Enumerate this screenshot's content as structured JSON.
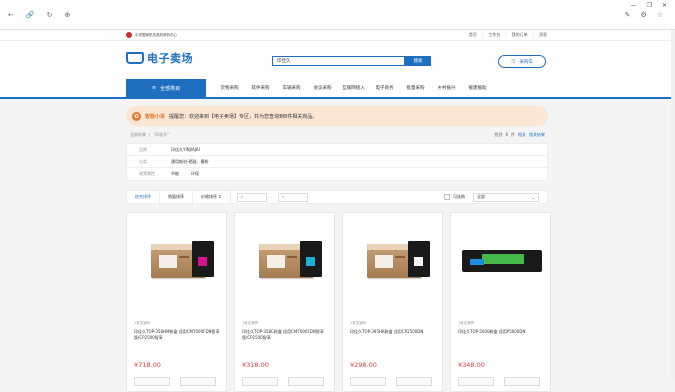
{
  "topbar": {
    "org": "中央国家机关政府采购中心",
    "links": [
      "首页",
      "工作台",
      "我的订单",
      "消息"
    ]
  },
  "header": {
    "logo": "电子卖场",
    "search_value": "印佳久",
    "search_button": "搜索",
    "cart": "采购车"
  },
  "nav": {
    "all_categories": "全部类目",
    "items": [
      "货物采购",
      "软件采购",
      "车辆采购",
      "会议采购",
      "互联网接入",
      "电子商务",
      "批量采购",
      "乡村振兴",
      "援建援助"
    ]
  },
  "notice": {
    "brand": "智能小采",
    "text": "提醒您：欢迎来到【电子卖场】专区，共为您查询到8件相关商品。"
  },
  "breadcrumb": [
    "全部结果",
    "/",
    "\"印佳久\""
  ],
  "found": {
    "prefix": "找到",
    "count": "8",
    "suffix": "件",
    "link1": "相关",
    "link2": "相关结果"
  },
  "filters": [
    {
      "label": "品牌",
      "values": [
        "印佳久YINJIAJIU"
      ]
    },
    {
      "label": "分类",
      "values": [
        "通用耗材-硒鼓、墨粉"
      ]
    },
    {
      "label": "政策属性",
      "values": [
        "节能",
        "环保"
      ]
    }
  ],
  "sort": {
    "comprehensive": "综合排序",
    "sales": "销量排序",
    "price": "价格排序 ↕",
    "min_placeholder": "¥",
    "max_placeholder": "¥",
    "dash": "-",
    "available": "可选购",
    "select_value": "全部"
  },
  "products": [
    {
      "store": "1家店铺有",
      "title": "印佳久TOP-358HM粉盒 适用CM7000FDN智享版/CP2500智享",
      "price": "¥718.00",
      "chip_color": "#d3138b"
    },
    {
      "store": "1家店铺有",
      "title": "印佳久TOP-358C粉盒 适用CM7000FDN智享版/CP2500智享",
      "price": "¥318.00",
      "chip_color": "#19b1d6"
    },
    {
      "store": "1家店铺有",
      "title": "印佳久TOP-395HK粉盒 适用CP2500DN",
      "price": "¥298.00",
      "chip_color": "#f2f2f2"
    },
    {
      "store": "1家店铺有",
      "title": "印佳久TOP-5000粉盒 适用P5000DN",
      "price": "¥348.00",
      "chip_color": "#46b84b"
    }
  ]
}
